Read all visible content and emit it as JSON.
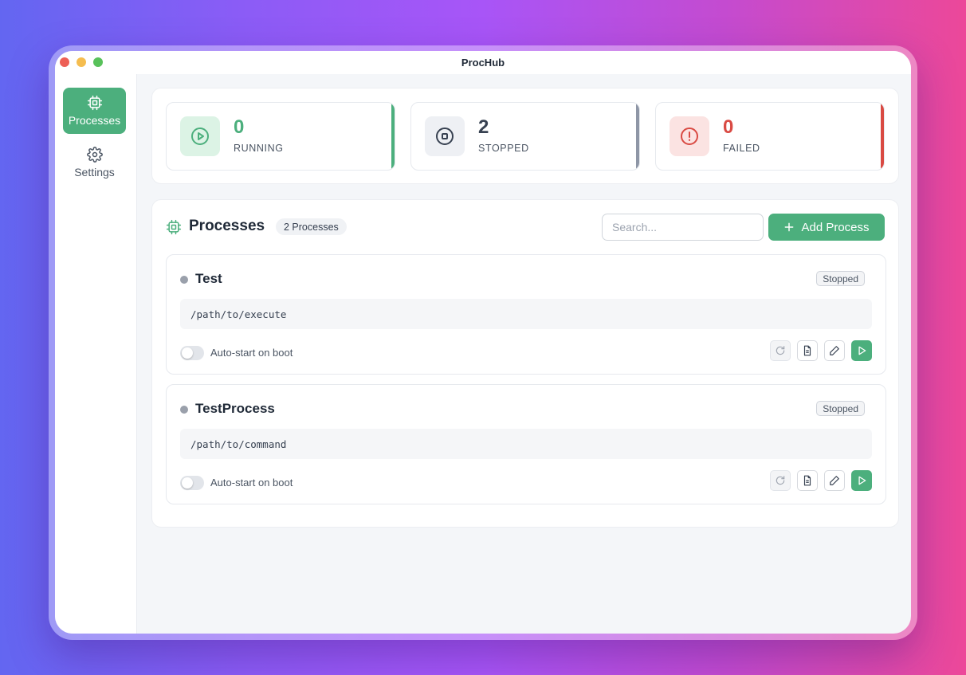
{
  "window": {
    "title": "ProcHub"
  },
  "sidebar": {
    "items": [
      {
        "label": "Processes",
        "icon": "cpu-icon",
        "active": true
      },
      {
        "label": "Settings",
        "icon": "gear-icon",
        "active": false
      }
    ]
  },
  "stats": {
    "running": {
      "value": "0",
      "label": "RUNNING",
      "color": "#4caf7d"
    },
    "stopped": {
      "value": "2",
      "label": "STOPPED",
      "color": "#8e96a6"
    },
    "failed": {
      "value": "0",
      "label": "FAILED",
      "color": "#d94a43"
    }
  },
  "processes": {
    "title": "Processes",
    "count_label": "2 Processes",
    "search_placeholder": "Search...",
    "add_label": "Add Process",
    "items": [
      {
        "name": "Test",
        "status": "Stopped",
        "command": "/path/to/execute",
        "autostart_label": "Auto-start on boot",
        "autostart": false
      },
      {
        "name": "TestProcess",
        "status": "Stopped",
        "command": "/path/to/command",
        "autostart_label": "Auto-start on boot",
        "autostart": false
      }
    ]
  },
  "colors": {
    "accent": "#4caf7d",
    "failed": "#d94a43",
    "stopped": "#8e96a6"
  }
}
